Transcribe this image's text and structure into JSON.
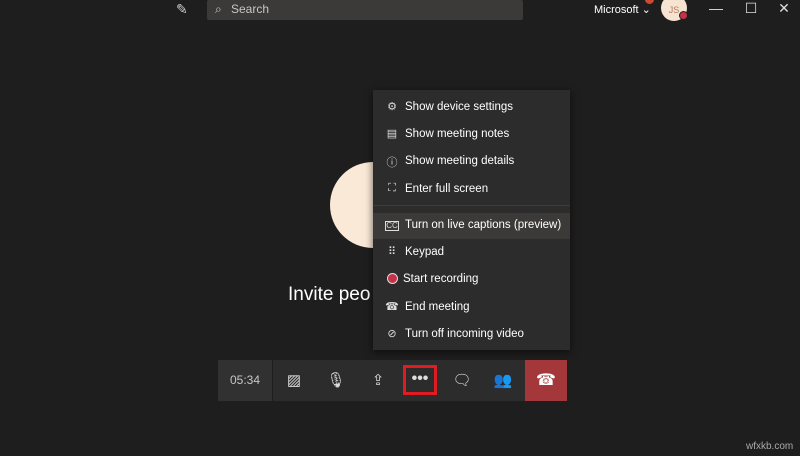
{
  "titlebar": {
    "search_placeholder": "Search",
    "org": "Microsoft",
    "avatar_initials": "JS"
  },
  "stage": {
    "invite_text": "Invite peo"
  },
  "menu": {
    "items": [
      {
        "label": "Show device settings",
        "icon": "gear-icon"
      },
      {
        "label": "Show meeting notes",
        "icon": "notes-icon"
      },
      {
        "label": "Show meeting details",
        "icon": "info-icon"
      },
      {
        "label": "Enter full screen",
        "icon": "fullscreen-icon"
      },
      {
        "label": "Turn on live captions (preview)",
        "icon": "captions-icon"
      },
      {
        "label": "Keypad",
        "icon": "keypad-icon"
      },
      {
        "label": "Start recording",
        "icon": "record-icon"
      },
      {
        "label": "End meeting",
        "icon": "end-meeting-icon"
      },
      {
        "label": "Turn off incoming video",
        "icon": "video-off-icon"
      }
    ]
  },
  "toolbar": {
    "timer": "05:34",
    "more_label": "•••"
  },
  "watermark": "wfxkb.com",
  "colors": {
    "hangup": "#a4373a",
    "highlight": "#e11b22",
    "record": "#c4314b"
  }
}
